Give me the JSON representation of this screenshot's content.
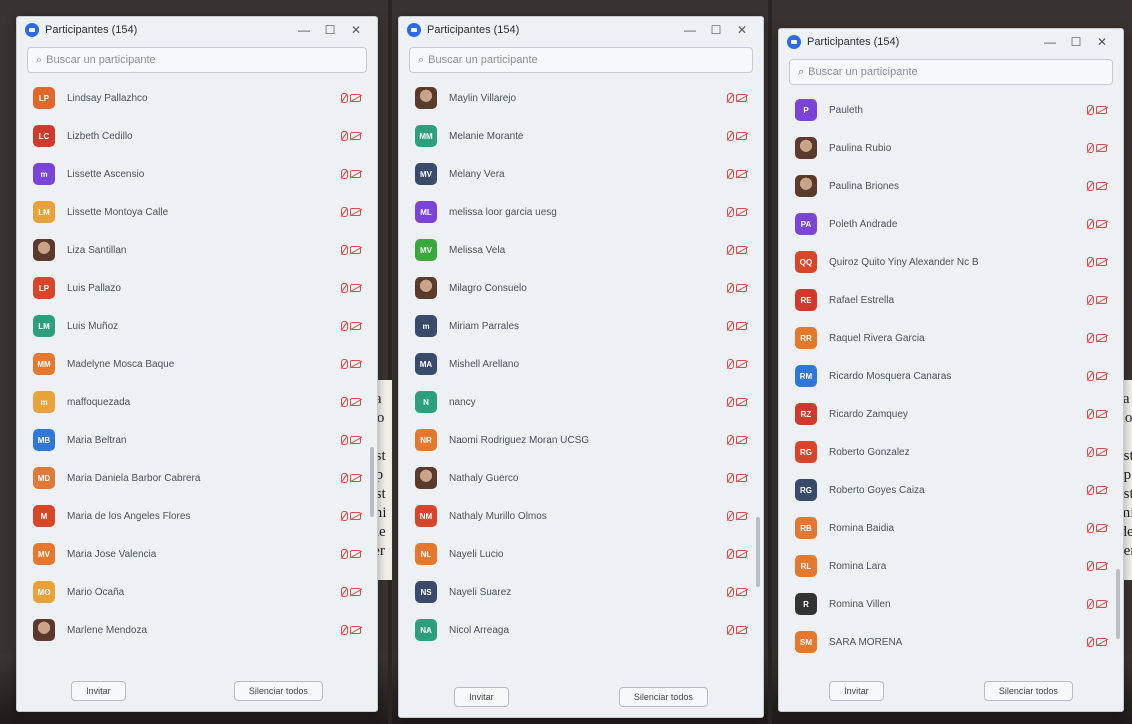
{
  "screenshots": [
    {
      "title": "Participantes (154)",
      "search_placeholder": "Buscar un participante",
      "invite_label": "Invitar",
      "mute_label": "Silenciar todos",
      "participants": [
        {
          "initials": "LP",
          "name": "Lindsay Pallazhco",
          "color": "#e0662a"
        },
        {
          "initials": "LC",
          "name": "Lizbeth Cedillo",
          "color": "#cf3a2c"
        },
        {
          "initials": "m",
          "name": "Lissette Ascensio",
          "color": "#7b43d6"
        },
        {
          "initials": "LM",
          "name": "Lissette Montoya Calle",
          "color": "#e8a23a"
        },
        {
          "initials": "",
          "name": "Liza Santillan",
          "color": "#b07c5e",
          "photo": true
        },
        {
          "initials": "LP",
          "name": "Luis Pallazo",
          "color": "#d8462a"
        },
        {
          "initials": "LM",
          "name": "Luis Muñoz",
          "color": "#2ca07d"
        },
        {
          "initials": "MM",
          "name": "Madelyne Mosca Baque",
          "color": "#e6782e"
        },
        {
          "initials": "m",
          "name": "maffoquezada",
          "color": "#e8a23a"
        },
        {
          "initials": "MB",
          "name": "Maria Beltran",
          "color": "#2f78d8"
        },
        {
          "initials": "MD",
          "name": "Maria Daniela Barbor Cabrera",
          "color": "#e07a3a"
        },
        {
          "initials": "M",
          "name": "Maria de los Angeles Flores",
          "color": "#d8462a"
        },
        {
          "initials": "MV",
          "name": "Maria Jose Valencia",
          "color": "#e6782e"
        },
        {
          "initials": "MO",
          "name": "Mario Ocaña",
          "color": "#e8a23a"
        },
        {
          "initials": "",
          "name": "Marlene Mendoza",
          "color": "#5a3d33",
          "photo": true
        }
      ]
    },
    {
      "title": "Participantes (154)",
      "search_placeholder": "Buscar un participante",
      "invite_label": "Invitar",
      "mute_label": "Silenciar todos",
      "participants": [
        {
          "initials": "",
          "name": "Maylin Villarejo",
          "color": "#b07c5e",
          "photo": true
        },
        {
          "initials": "MM",
          "name": "Melanie Morante",
          "color": "#2ca07d"
        },
        {
          "initials": "MV",
          "name": "Melany Vera",
          "color": "#3a4a6b"
        },
        {
          "initials": "ML",
          "name": "melissa loor garcia uesg",
          "color": "#7b43d6"
        },
        {
          "initials": "MV",
          "name": "Melissa Vela",
          "color": "#3aa83a"
        },
        {
          "initials": "",
          "name": "Milagro Consuelo",
          "color": "#8a5a3a",
          "photo": true
        },
        {
          "initials": "m",
          "name": "Miriam Parrales",
          "color": "#3a4a6b"
        },
        {
          "initials": "MA",
          "name": "Mishell Arellano",
          "color": "#3a4a6b"
        },
        {
          "initials": "N",
          "name": "nancy",
          "color": "#2ca07d"
        },
        {
          "initials": "NR",
          "name": "Naomi Rodriguez Moran UCSG",
          "color": "#e6782e"
        },
        {
          "initials": "",
          "name": "Nathaly Guerco",
          "color": "#6a6a6a",
          "photo": true
        },
        {
          "initials": "NM",
          "name": "Nathaly Murillo Olmos",
          "color": "#d8462a"
        },
        {
          "initials": "NL",
          "name": "Nayeli Lucio",
          "color": "#e6782e"
        },
        {
          "initials": "NS",
          "name": "Nayeli Suarez",
          "color": "#3a4a6b"
        },
        {
          "initials": "NA",
          "name": "Nicol Arreaga",
          "color": "#2ca07d"
        }
      ]
    },
    {
      "title": "Participantes (154)",
      "search_placeholder": "Buscar un participante",
      "invite_label": "Invitar",
      "mute_label": "Silenciar todos",
      "participants": [
        {
          "initials": "P",
          "name": "Pauleth",
          "color": "#7b43d6"
        },
        {
          "initials": "",
          "name": "Paulina Rubio",
          "color": "#b07c5e",
          "photo": true
        },
        {
          "initials": "",
          "name": "Paulina Briones",
          "color": "#5a3d33",
          "photo": true
        },
        {
          "initials": "PA",
          "name": "Poleth Andrade",
          "color": "#7b43d6"
        },
        {
          "initials": "QQ",
          "name": "Quiroz Quito Yiny Alexander Nc B",
          "color": "#d8462a"
        },
        {
          "initials": "RE",
          "name": "Rafael Estrella",
          "color": "#cf3a2c"
        },
        {
          "initials": "RR",
          "name": "Raquel Rivera Garcia",
          "color": "#e6782e"
        },
        {
          "initials": "RM",
          "name": "Ricardo Mosquera Canaras",
          "color": "#2f78d8"
        },
        {
          "initials": "RZ",
          "name": "Ricardo Zamquey",
          "color": "#cf3a2c"
        },
        {
          "initials": "RG",
          "name": "Roberto Gonzalez",
          "color": "#d8462a"
        },
        {
          "initials": "RG",
          "name": "Roberto Goyes Caiza",
          "color": "#3a4a6b"
        },
        {
          "initials": "RB",
          "name": "Romina Baidia",
          "color": "#e6782e"
        },
        {
          "initials": "RL",
          "name": "Romina Lara",
          "color": "#e6782e"
        },
        {
          "initials": "R",
          "name": "Romina Villen",
          "color": "#333333"
        },
        {
          "initials": "SM",
          "name": "SARA MORENA",
          "color": "#e6782e"
        }
      ]
    }
  ],
  "doc_fragments": {
    "left": [
      "ala",
      "r lo",
      "tr",
      "inst",
      "mp",
      "inst",
      "ami",
      "bde",
      "fier"
    ],
    "right": [
      "ala",
      "r lo",
      "tr",
      "inst",
      "mp",
      "inst",
      "ami",
      "bde",
      "hier"
    ]
  }
}
